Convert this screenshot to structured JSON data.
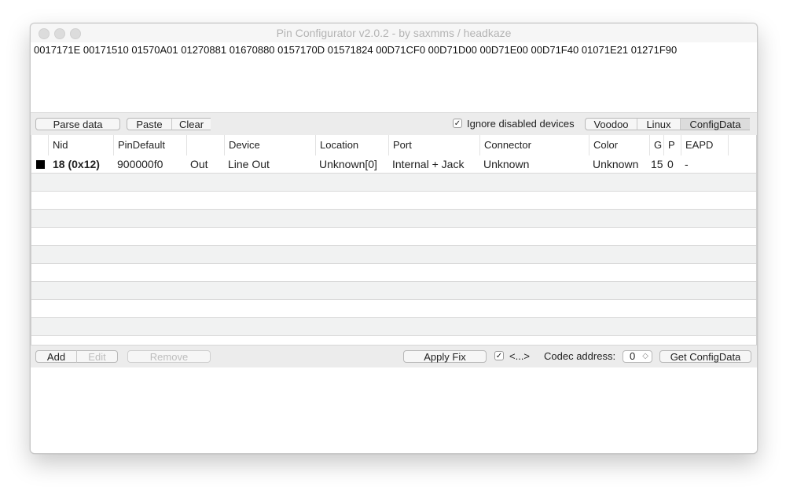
{
  "window": {
    "title": "Pin Configurator v2.0.2 - by saxmms / headkaze"
  },
  "hex_input": {
    "value": "0017171E 00171510 01570A01 01270881 01670880 0157170D 01571824 00D71CF0 00D71D00 00D71E00 00D71F40 01071E21 01271F90"
  },
  "top_toolbar": {
    "parse_label": "Parse data",
    "paste_label": "Paste",
    "clear_label": "Clear",
    "ignore_disabled_label": "Ignore disabled devices",
    "ignore_disabled_checked": true,
    "check_glyph": "✓",
    "format_tabs": [
      {
        "label": "Voodoo",
        "selected": false
      },
      {
        "label": "Linux",
        "selected": false
      },
      {
        "label": "ConfigData",
        "selected": true
      }
    ]
  },
  "table": {
    "columns": [
      "",
      "Nid",
      "PinDefault",
      "",
      "Device",
      "Location",
      "Port",
      "Connector",
      "Color",
      "G",
      "P",
      "EAPD",
      ""
    ],
    "rows": [
      {
        "color_swatch": "#000000",
        "nid": "18 (0x12)",
        "pin_default": "900000f0",
        "direction": "Out",
        "device": "Line Out",
        "location": "Unknown[0]",
        "port": "Internal + Jack",
        "connector": "Unknown",
        "color": "Unknown",
        "g": "15",
        "p": "0",
        "eapd": "-"
      }
    ]
  },
  "bottom_toolbar": {
    "add_label": "Add",
    "edit_label": "Edit",
    "remove_label": "Remove",
    "apply_fix_label": "Apply Fix",
    "ellipsis_checked": true,
    "ellipsis_label": "<...>",
    "codec_address_label": "Codec address:",
    "codec_address_value": "0",
    "stepper_glyph": "◇",
    "get_config_label": "Get ConfigData"
  }
}
